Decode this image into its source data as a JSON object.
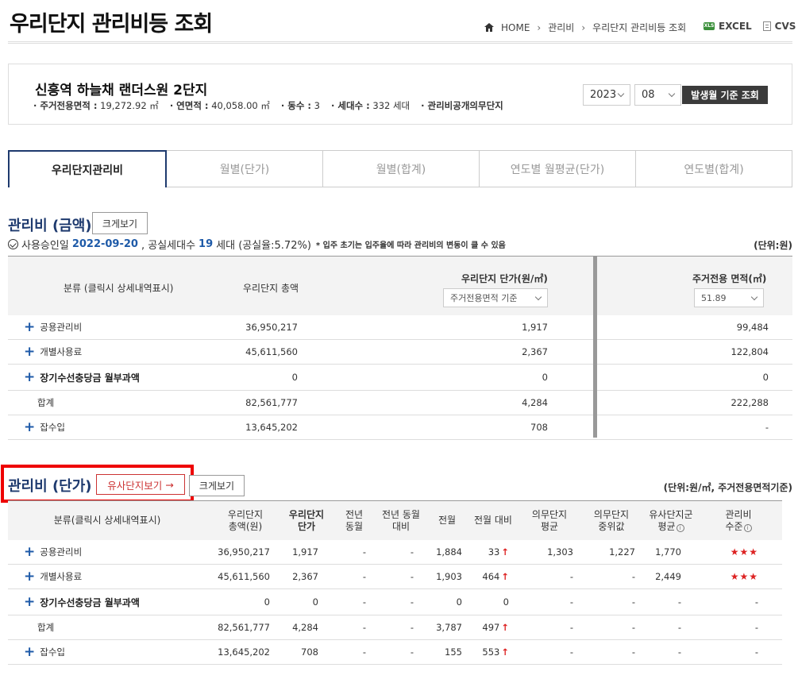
{
  "header": {
    "title": "우리단지 관리비등 조회",
    "breadcrumb": [
      "HOME",
      "관리비",
      "우리단지 관리비등 조회"
    ],
    "excel_label": "EXCEL",
    "cvs_label": "CVS"
  },
  "complex": {
    "name": "신흥역 하늘채 랜더스원 2단지",
    "info": [
      {
        "label": "· 주거전용면적 :",
        "value": "19,272.92 ㎡"
      },
      {
        "label": "· 연면적 :",
        "value": "40,058.00 ㎡"
      },
      {
        "label": "· 동수 :",
        "value": "3"
      },
      {
        "label": "· 세대수 :",
        "value": "332 세대"
      },
      {
        "label": "· 관리비공개의무단지",
        "value": ""
      }
    ],
    "year": "2023",
    "month": "08",
    "search_button": "발생월 기준 조회"
  },
  "tabs": [
    "우리단지관리비",
    "월별(단가)",
    "월별(합계)",
    "연도별 월평균(단가)",
    "연도별(합계)"
  ],
  "section1": {
    "title": "관리비 (금액)",
    "big_view": "크게보기",
    "note_prefix": "사용승인일",
    "approval_date": "2022-09-20",
    "note_mid": ", 공실세대수",
    "vacant_count": "19",
    "note_suffix": "세대 (공실율:5.72%)",
    "note_small": "입주 초기는 입주율에 따라 관리비의 변동이 클 수 있음",
    "unit": "(단위:원)",
    "headers": {
      "category": "분류 (클릭시 상세내역표시)",
      "total": "우리단지 총액",
      "unit_price": "우리단지 단가(원/㎡)",
      "unit_price_select": "주거전용면적 기준",
      "area": "주거전용 면적(㎡)",
      "area_select": "51.89"
    },
    "rows": [
      {
        "label": "공용관리비",
        "total": "36,950,217",
        "unit": "1,917",
        "area": "99,484"
      },
      {
        "label": "개별사용료",
        "total": "45,611,560",
        "unit": "2,367",
        "area": "122,804"
      },
      {
        "label": "장기수선충당금 월부과액",
        "total": "0",
        "unit": "0",
        "area": "0"
      },
      {
        "label": "합계",
        "total": "82,561,777",
        "unit": "4,284",
        "area": "222,288"
      },
      {
        "label": "잡수입",
        "total": "13,645,202",
        "unit": "708",
        "area": "-"
      }
    ]
  },
  "section2": {
    "title": "관리비 (단가)",
    "similar_button": "유사단지보기",
    "big_view": "크게보기",
    "unit": "(단위:원/㎡, 주거전용면적기준)",
    "headers": {
      "category": "분류(클릭시 상세내역표시)",
      "total": "우리단지\n총액(원)",
      "unit": "우리단지\n단가",
      "prev_year": "전년\n동월",
      "prev_year_diff": "전년 동월\n대비",
      "prev_month": "전월",
      "prev_month_diff": "전월 대비",
      "duty_avg": "의무단지\n평균",
      "duty_median": "의무단지\n중위값",
      "similar_avg": "유사단지군\n평균",
      "level": "관리비\n수준"
    },
    "rows": [
      {
        "label": "공용관리비",
        "total": "36,950,217",
        "unit": "1,917",
        "prev_year": "-",
        "prev_year_diff": "-",
        "prev_month": "1,884",
        "diff": "33",
        "up": true,
        "duty_avg": "1,303",
        "duty_median": "1,227",
        "similar_avg": "1,770",
        "level": "★★★"
      },
      {
        "label": "개별사용료",
        "total": "45,611,560",
        "unit": "2,367",
        "prev_year": "-",
        "prev_year_diff": "-",
        "prev_month": "1,903",
        "diff": "464",
        "up": true,
        "duty_avg": "-",
        "duty_median": "-",
        "similar_avg": "2,449",
        "level": "★★★"
      },
      {
        "label": "장기수선충당금 월부과액",
        "total": "0",
        "unit": "0",
        "prev_year": "-",
        "prev_year_diff": "-",
        "prev_month": "0",
        "diff": "0",
        "up": false,
        "duty_avg": "-",
        "duty_median": "-",
        "similar_avg": "-",
        "level": "-"
      },
      {
        "label": "합계",
        "total": "82,561,777",
        "unit": "4,284",
        "prev_year": "-",
        "prev_year_diff": "-",
        "prev_month": "3,787",
        "diff": "497",
        "up": true,
        "duty_avg": "-",
        "duty_median": "-",
        "similar_avg": "-",
        "level": "-"
      },
      {
        "label": "잡수입",
        "total": "13,645,202",
        "unit": "708",
        "prev_year": "-",
        "prev_year_diff": "-",
        "prev_month": "155",
        "diff": "553",
        "up": true,
        "duty_avg": "-",
        "duty_median": "-",
        "similar_avg": "-",
        "level": "-"
      }
    ]
  }
}
